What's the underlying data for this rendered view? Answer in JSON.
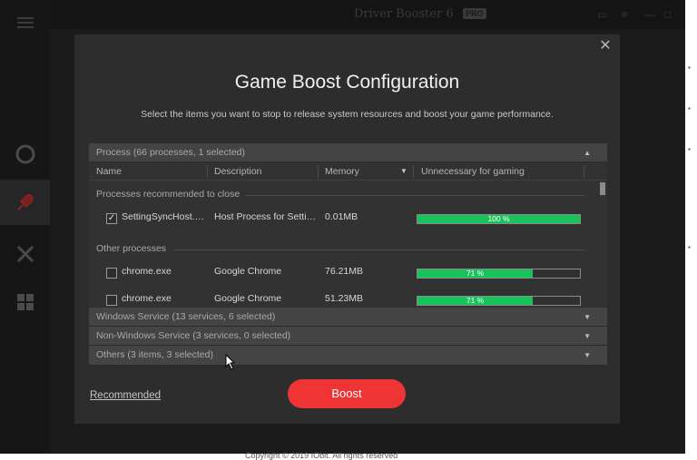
{
  "background_app": {
    "title": "Driver Booster 6",
    "badge": "PRO",
    "footer_text": "Copyright © 2019 IObit. All rights reserved"
  },
  "dialog": {
    "title": "Game Boost Configuration",
    "subtitle": "Select the items you want to stop to release system resources and boost your game performance.",
    "close_label": "✕"
  },
  "process_section": {
    "header": "Process (66 processes, 1 selected)",
    "columns": [
      "Name",
      "Description",
      "Memory",
      "Unnecessary for gaming"
    ],
    "groups": [
      {
        "label": "Processes recommended to close",
        "rows": [
          {
            "checked": true,
            "name": "SettingSyncHost.…",
            "description": "Host Process for Setti…",
            "memory": "0.01MB",
            "unnecessary_percent": 100,
            "unnecessary_label": "100 %"
          }
        ]
      },
      {
        "label": "Other processes",
        "rows": [
          {
            "checked": false,
            "name": "chrome.exe",
            "description": "Google Chrome",
            "memory": "76.21MB",
            "unnecessary_percent": 71,
            "unnecessary_label": "71 %"
          },
          {
            "checked": false,
            "name": "chrome.exe",
            "description": "Google Chrome",
            "memory": "51.23MB",
            "unnecessary_percent": 71,
            "unnecessary_label": "71 %"
          }
        ]
      }
    ]
  },
  "other_sections": [
    {
      "label": "Windows Service (13 services, 6 selected)"
    },
    {
      "label": "Non-Windows Service (3 services, 0 selected)"
    },
    {
      "label": "Others (3 items, 3 selected)"
    }
  ],
  "footer": {
    "recommended_label": "Recommended",
    "boost_label": "Boost"
  },
  "colors": {
    "accent_red": "#ee3434",
    "progress_green": "#19c35c",
    "dialog_bg": "#2d2d2e"
  }
}
